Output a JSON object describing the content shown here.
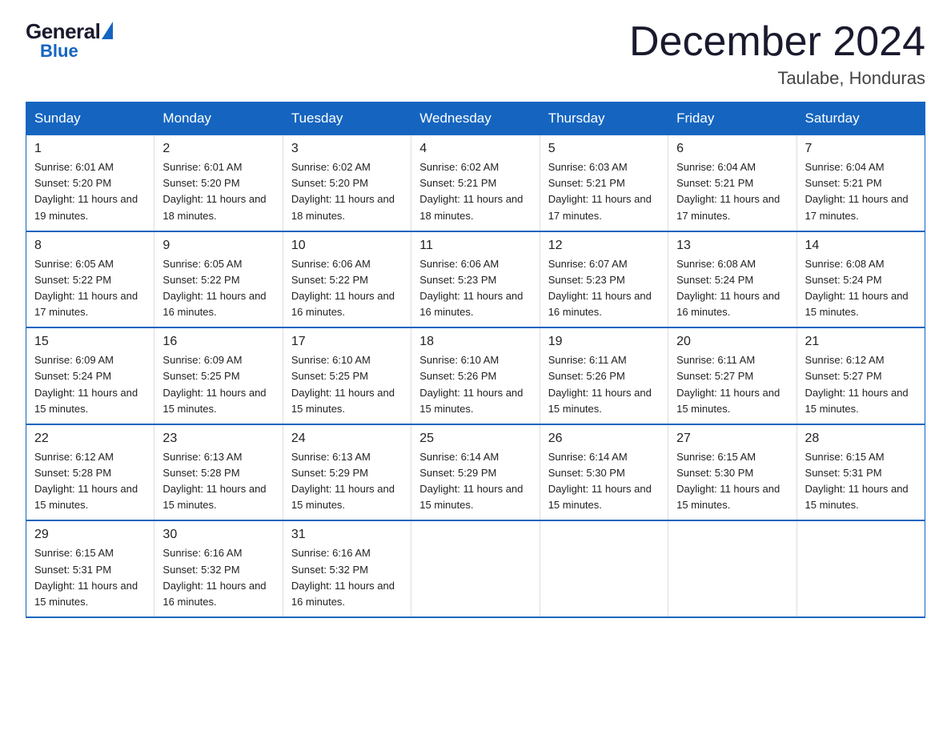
{
  "logo": {
    "general": "General",
    "blue": "Blue"
  },
  "title": "December 2024",
  "location": "Taulabe, Honduras",
  "days_of_week": [
    "Sunday",
    "Monday",
    "Tuesday",
    "Wednesday",
    "Thursday",
    "Friday",
    "Saturday"
  ],
  "weeks": [
    [
      {
        "date": "1",
        "sunrise": "6:01 AM",
        "sunset": "5:20 PM",
        "daylight": "11 hours and 19 minutes."
      },
      {
        "date": "2",
        "sunrise": "6:01 AM",
        "sunset": "5:20 PM",
        "daylight": "11 hours and 18 minutes."
      },
      {
        "date": "3",
        "sunrise": "6:02 AM",
        "sunset": "5:20 PM",
        "daylight": "11 hours and 18 minutes."
      },
      {
        "date": "4",
        "sunrise": "6:02 AM",
        "sunset": "5:21 PM",
        "daylight": "11 hours and 18 minutes."
      },
      {
        "date": "5",
        "sunrise": "6:03 AM",
        "sunset": "5:21 PM",
        "daylight": "11 hours and 17 minutes."
      },
      {
        "date": "6",
        "sunrise": "6:04 AM",
        "sunset": "5:21 PM",
        "daylight": "11 hours and 17 minutes."
      },
      {
        "date": "7",
        "sunrise": "6:04 AM",
        "sunset": "5:21 PM",
        "daylight": "11 hours and 17 minutes."
      }
    ],
    [
      {
        "date": "8",
        "sunrise": "6:05 AM",
        "sunset": "5:22 PM",
        "daylight": "11 hours and 17 minutes."
      },
      {
        "date": "9",
        "sunrise": "6:05 AM",
        "sunset": "5:22 PM",
        "daylight": "11 hours and 16 minutes."
      },
      {
        "date": "10",
        "sunrise": "6:06 AM",
        "sunset": "5:22 PM",
        "daylight": "11 hours and 16 minutes."
      },
      {
        "date": "11",
        "sunrise": "6:06 AM",
        "sunset": "5:23 PM",
        "daylight": "11 hours and 16 minutes."
      },
      {
        "date": "12",
        "sunrise": "6:07 AM",
        "sunset": "5:23 PM",
        "daylight": "11 hours and 16 minutes."
      },
      {
        "date": "13",
        "sunrise": "6:08 AM",
        "sunset": "5:24 PM",
        "daylight": "11 hours and 16 minutes."
      },
      {
        "date": "14",
        "sunrise": "6:08 AM",
        "sunset": "5:24 PM",
        "daylight": "11 hours and 15 minutes."
      }
    ],
    [
      {
        "date": "15",
        "sunrise": "6:09 AM",
        "sunset": "5:24 PM",
        "daylight": "11 hours and 15 minutes."
      },
      {
        "date": "16",
        "sunrise": "6:09 AM",
        "sunset": "5:25 PM",
        "daylight": "11 hours and 15 minutes."
      },
      {
        "date": "17",
        "sunrise": "6:10 AM",
        "sunset": "5:25 PM",
        "daylight": "11 hours and 15 minutes."
      },
      {
        "date": "18",
        "sunrise": "6:10 AM",
        "sunset": "5:26 PM",
        "daylight": "11 hours and 15 minutes."
      },
      {
        "date": "19",
        "sunrise": "6:11 AM",
        "sunset": "5:26 PM",
        "daylight": "11 hours and 15 minutes."
      },
      {
        "date": "20",
        "sunrise": "6:11 AM",
        "sunset": "5:27 PM",
        "daylight": "11 hours and 15 minutes."
      },
      {
        "date": "21",
        "sunrise": "6:12 AM",
        "sunset": "5:27 PM",
        "daylight": "11 hours and 15 minutes."
      }
    ],
    [
      {
        "date": "22",
        "sunrise": "6:12 AM",
        "sunset": "5:28 PM",
        "daylight": "11 hours and 15 minutes."
      },
      {
        "date": "23",
        "sunrise": "6:13 AM",
        "sunset": "5:28 PM",
        "daylight": "11 hours and 15 minutes."
      },
      {
        "date": "24",
        "sunrise": "6:13 AM",
        "sunset": "5:29 PM",
        "daylight": "11 hours and 15 minutes."
      },
      {
        "date": "25",
        "sunrise": "6:14 AM",
        "sunset": "5:29 PM",
        "daylight": "11 hours and 15 minutes."
      },
      {
        "date": "26",
        "sunrise": "6:14 AM",
        "sunset": "5:30 PM",
        "daylight": "11 hours and 15 minutes."
      },
      {
        "date": "27",
        "sunrise": "6:15 AM",
        "sunset": "5:30 PM",
        "daylight": "11 hours and 15 minutes."
      },
      {
        "date": "28",
        "sunrise": "6:15 AM",
        "sunset": "5:31 PM",
        "daylight": "11 hours and 15 minutes."
      }
    ],
    [
      {
        "date": "29",
        "sunrise": "6:15 AM",
        "sunset": "5:31 PM",
        "daylight": "11 hours and 15 minutes."
      },
      {
        "date": "30",
        "sunrise": "6:16 AM",
        "sunset": "5:32 PM",
        "daylight": "11 hours and 16 minutes."
      },
      {
        "date": "31",
        "sunrise": "6:16 AM",
        "sunset": "5:32 PM",
        "daylight": "11 hours and 16 minutes."
      },
      {
        "date": "",
        "sunrise": "",
        "sunset": "",
        "daylight": ""
      },
      {
        "date": "",
        "sunrise": "",
        "sunset": "",
        "daylight": ""
      },
      {
        "date": "",
        "sunrise": "",
        "sunset": "",
        "daylight": ""
      },
      {
        "date": "",
        "sunrise": "",
        "sunset": "",
        "daylight": ""
      }
    ]
  ]
}
